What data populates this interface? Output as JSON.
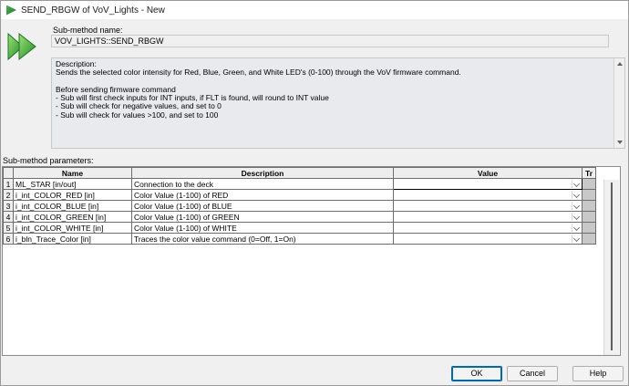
{
  "window": {
    "title": "SEND_RBGW of VoV_Lights - New",
    "icon": "green-arrow-icon"
  },
  "submethod": {
    "name_label": "Sub-method name:",
    "name_value": "VOV_LIGHTS::SEND_RBGW"
  },
  "description": {
    "lines": [
      "Description:",
      "Sends the selected color intensity for Red, Blue, Green, and White LED's (0-100) through the VoV firmware command.",
      "",
      "Before sending firmware command",
      "- Sub will first check inputs for INT inputs, if FLT is found, will round to INT value",
      "- Sub will check for negative values, and set to 0",
      "- Sub will check for values >100, and set to 100"
    ]
  },
  "params": {
    "label": "Sub-method parameters:",
    "headers": [
      "Name",
      "Description",
      "Value",
      "Tr"
    ],
    "rows": [
      {
        "num": "1",
        "name": "ML_STAR [in/out]",
        "desc": "Connection to the deck",
        "value": ""
      },
      {
        "num": "2",
        "name": "i_int_COLOR_RED [in]",
        "desc": "Color Value (1-100) of RED",
        "value": ""
      },
      {
        "num": "3",
        "name": "i_int_COLOR_BLUE [in]",
        "desc": "Color Value (1-100) of BLUE",
        "value": ""
      },
      {
        "num": "4",
        "name": "i_int_COLOR_GREEN [in]",
        "desc": "Color Value (1-100) of GREEN",
        "value": ""
      },
      {
        "num": "5",
        "name": "i_int_COLOR_WHITE [in]",
        "desc": "Color Value (1-100) of WHITE",
        "value": ""
      },
      {
        "num": "6",
        "name": "i_bln_Trace_Color [in]",
        "desc": "Traces the color value command (0=Off, 1=On)",
        "value": ""
      }
    ]
  },
  "buttons": {
    "ok": "OK",
    "cancel": "Cancel",
    "help": "Help"
  },
  "colors": {
    "accent": "#0067c0",
    "arrow_green": "#2e9e3a"
  }
}
